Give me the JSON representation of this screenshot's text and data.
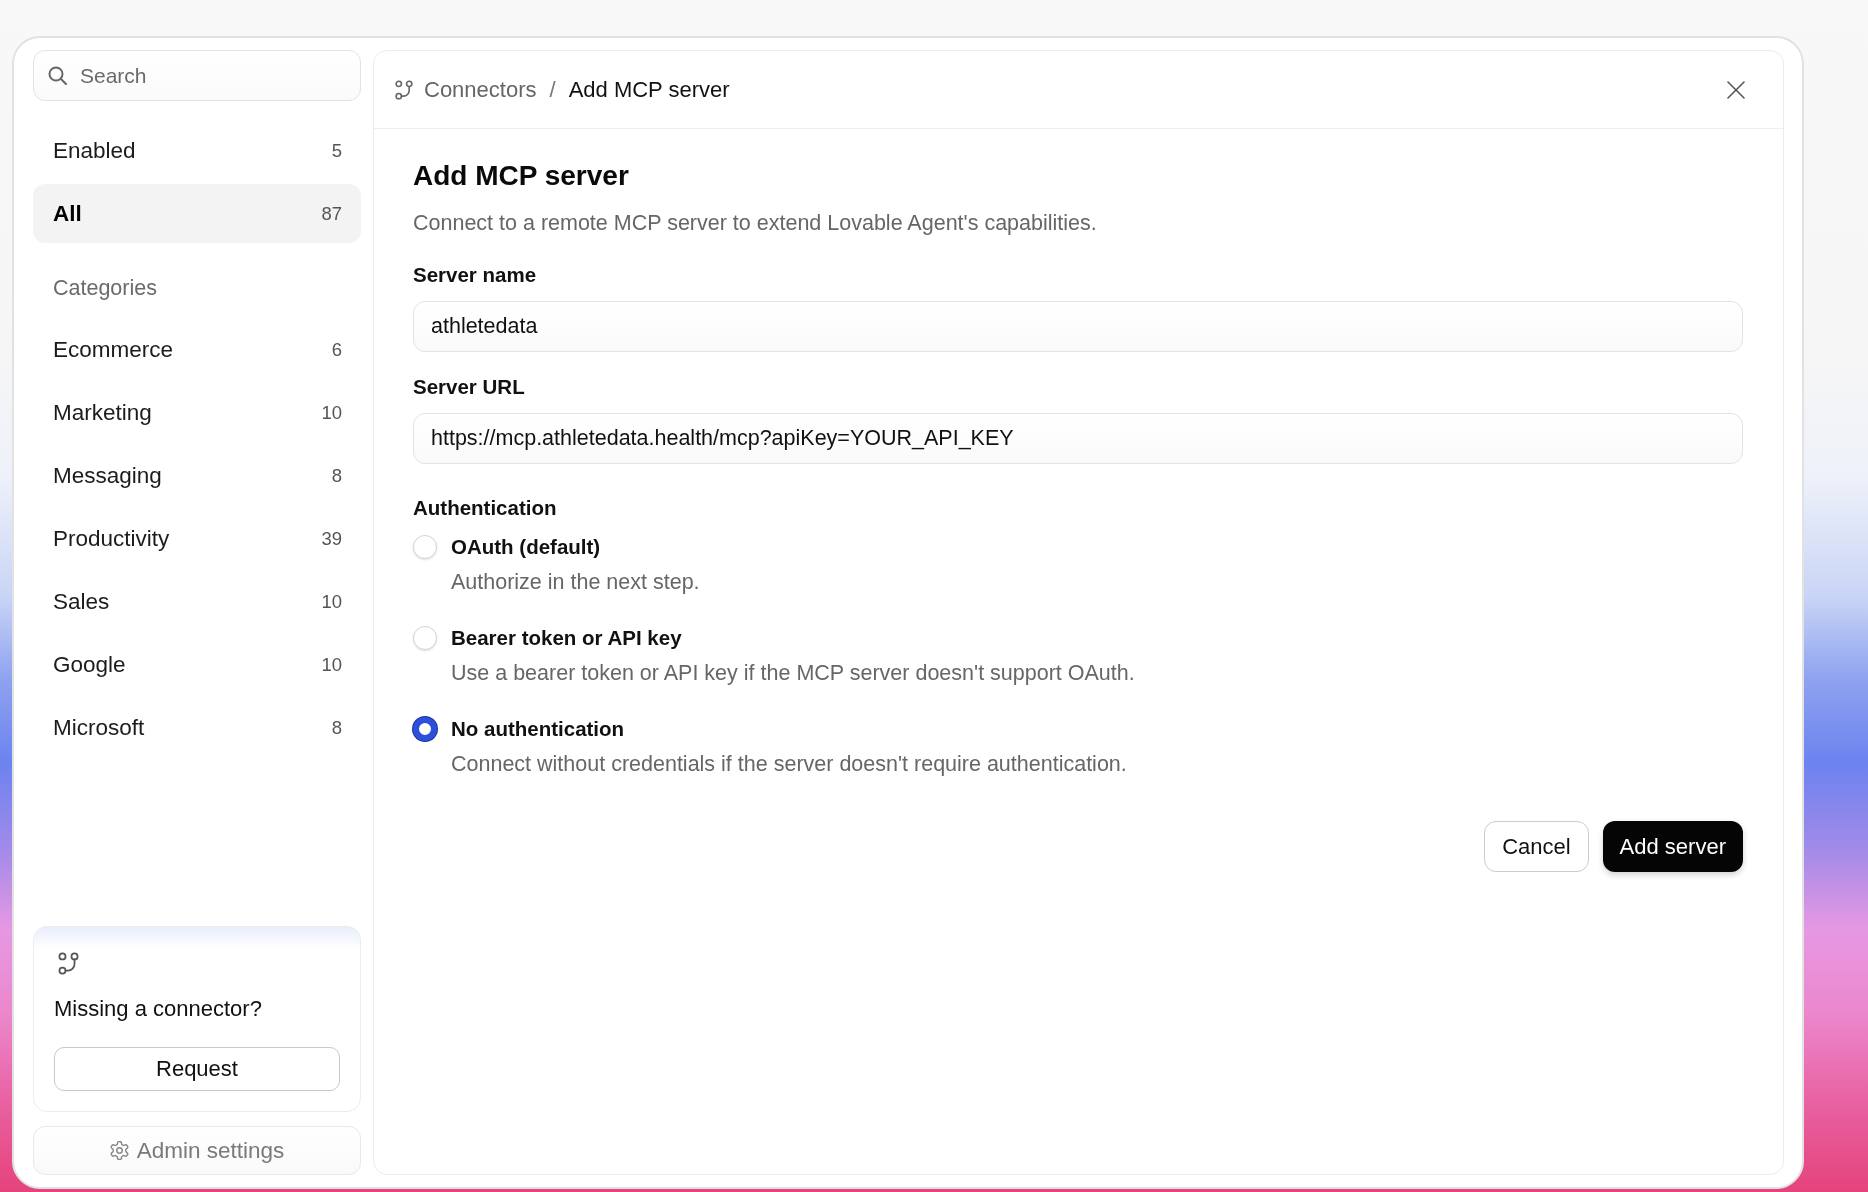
{
  "sidebar": {
    "search": {
      "placeholder": "Search"
    },
    "filters": [
      {
        "label": "Enabled",
        "count": "5",
        "selected": false
      },
      {
        "label": "All",
        "count": "87",
        "selected": true
      }
    ],
    "categories_heading": "Categories",
    "categories": [
      {
        "label": "Ecommerce",
        "count": "6",
        "selected": false
      },
      {
        "label": "Marketing",
        "count": "10",
        "selected": false
      },
      {
        "label": "Messaging",
        "count": "8",
        "selected": false
      },
      {
        "label": "Productivity",
        "count": "39",
        "selected": false
      },
      {
        "label": "Sales",
        "count": "10",
        "selected": false
      },
      {
        "label": "Google",
        "count": "10",
        "selected": false
      },
      {
        "label": "Microsoft",
        "count": "8",
        "selected": false
      }
    ],
    "request_card": {
      "title": "Missing a connector?",
      "button": "Request"
    },
    "admin_button": "Admin settings"
  },
  "breadcrumb": {
    "parent": "Connectors",
    "separator": "/",
    "current": "Add MCP server"
  },
  "form": {
    "title": "Add MCP server",
    "subtitle": "Connect to a remote MCP server to extend Lovable Agent's capabilities.",
    "fields": [
      {
        "label": "Server name",
        "value": "athletedata"
      },
      {
        "label": "Server URL",
        "value": "https://mcp.athletedata.health/mcp?apiKey=YOUR_API_KEY"
      }
    ],
    "authentication": {
      "label": "Authentication",
      "options": [
        {
          "label": "OAuth (default)",
          "description": "Authorize in the next step.",
          "selected": false
        },
        {
          "label": "Bearer token or API key",
          "description": "Use a bearer token or API key if the MCP server doesn't support OAuth.",
          "selected": false
        },
        {
          "label": "No authentication",
          "description": "Connect without credentials if the server doesn't require authentication.",
          "selected": true
        }
      ]
    },
    "buttons": [
      {
        "label": "Cancel",
        "kind": "secondary"
      },
      {
        "label": "Add server",
        "kind": "primary"
      }
    ]
  }
}
